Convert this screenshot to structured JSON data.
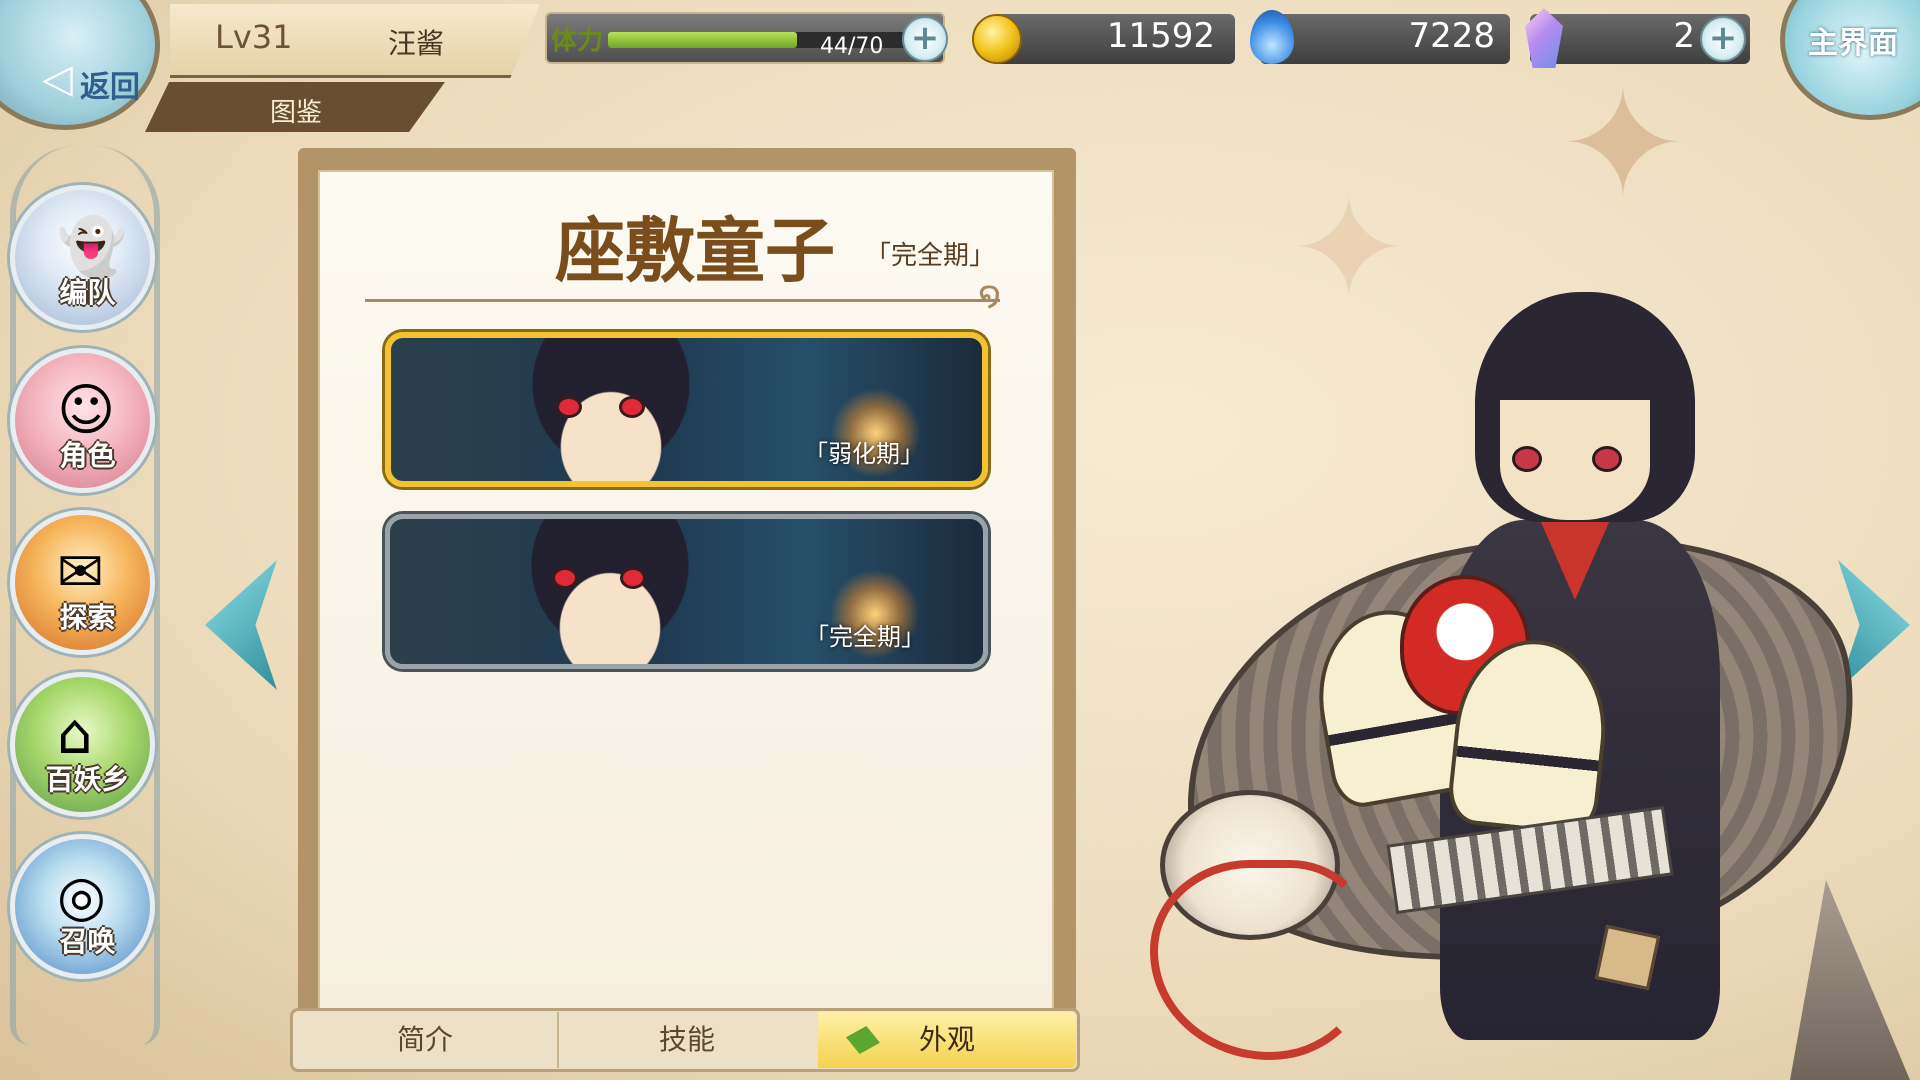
{
  "header": {
    "back_label": "返回",
    "level": "Lv31",
    "player_name": "汪酱",
    "page_title": "图鉴",
    "home_label": "主界面"
  },
  "resources": {
    "stamina_label": "体力",
    "stamina_value": "44/70",
    "stamina_current": 44,
    "stamina_max": 70,
    "gold": "11592",
    "soulfire": "7228",
    "gems": "2"
  },
  "sidebar": {
    "items": [
      {
        "label": "编队",
        "icon": "ghost-knight-icon"
      },
      {
        "label": "角色",
        "icon": "character-portrait-icon"
      },
      {
        "label": "探索",
        "icon": "scroll-map-icon"
      },
      {
        "label": "百妖乡",
        "icon": "village-hut-icon"
      },
      {
        "label": "召唤",
        "icon": "summon-swirl-icon"
      }
    ]
  },
  "panel": {
    "character_name": "座敷童子",
    "current_stage": "「完全期」",
    "forms": [
      {
        "label": "「弱化期」",
        "selected": true
      },
      {
        "label": "「完全期」",
        "selected": false
      }
    ]
  },
  "tabs": {
    "intro": "简介",
    "skills": "技能",
    "appearance": "外观",
    "active": "appearance"
  },
  "colors": {
    "accent_gold": "#f2c230",
    "stamina_green": "#6ea526",
    "panel_brown": "#7a4e1c"
  }
}
